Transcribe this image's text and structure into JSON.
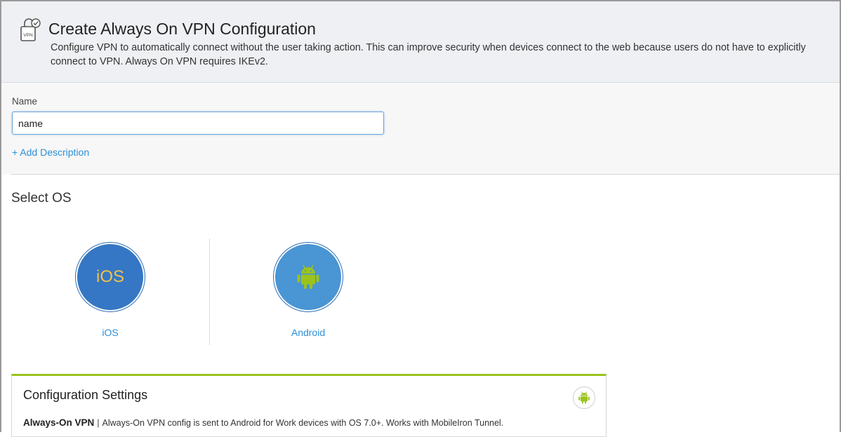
{
  "header": {
    "title": "Create Always On VPN Configuration",
    "description": "Configure VPN to automatically connect without the user taking action. This can improve security when devices connect to the web because users do not have to explicitly connect to VPN. Always On VPN requires IKEv2.",
    "icon_text": "VPN",
    "icon": "vpn-lock-check-icon"
  },
  "name_field": {
    "label": "Name",
    "value": "name",
    "add_description": "+ Add Description"
  },
  "select_os": {
    "title": "Select OS",
    "options": [
      {
        "label": "iOS",
        "badge_text": "iOS",
        "icon": "ios-badge-icon"
      },
      {
        "label": "Android",
        "icon": "android-robot-icon"
      }
    ]
  },
  "config": {
    "title": "Configuration Settings",
    "badge_icon": "android-robot-icon",
    "item_name": "Always-On VPN",
    "separator": "|",
    "item_desc": "Always-On VPN config is sent to Android for Work devices with OS 7.0+. Works with MobileIron Tunnel."
  },
  "colors": {
    "accent_link": "#2c8fd6",
    "ios_circle": "#3577c4",
    "ios_text": "#f5c04a",
    "android_circle": "#4a95d3",
    "android_green": "#9bc31c",
    "config_border_top": "#9bc31c"
  }
}
